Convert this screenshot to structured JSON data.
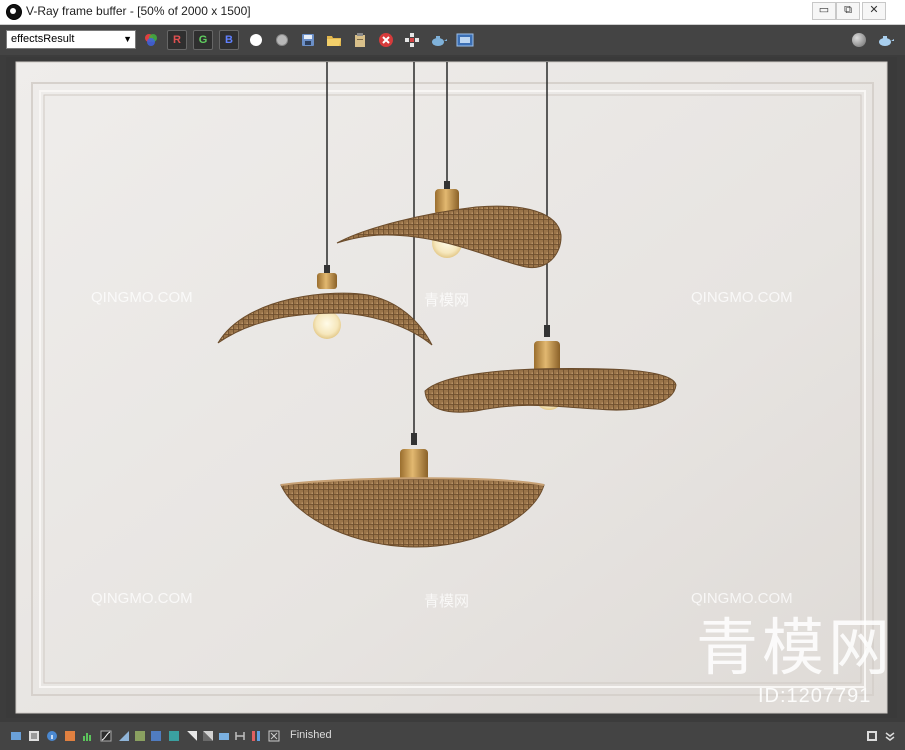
{
  "window": {
    "title": "V-Ray frame buffer - [50% of 2000 x 1500]",
    "minimize_label": "▭",
    "restore_label": "⧉",
    "close_label": "✕"
  },
  "toolbar": {
    "channel_value": "effectsResult",
    "red_label": "R",
    "green_label": "G",
    "blue_label": "B"
  },
  "status": {
    "text": "Finished"
  },
  "watermarks": {
    "latin": "QINGMO.COM",
    "chinese_small": "青模网",
    "chinese_large": "青模网",
    "id_text": "ID:1207791"
  },
  "colors": {
    "wall": "#e9e6e3",
    "brass": "#c99a52",
    "rattan": "#9a7449"
  }
}
